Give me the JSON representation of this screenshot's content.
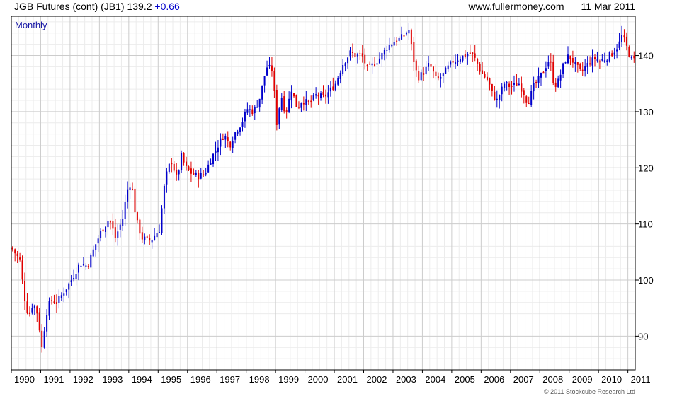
{
  "header": {
    "instrument": "JGB Futures (cont) (JB1)",
    "last": "139.2",
    "change": "+0.66",
    "site": "www.fullermoney.com",
    "date": "11 Mar 2011"
  },
  "copyright": "© 2011 Stockcube Research Ltd",
  "colors": {
    "up": "#0000cc",
    "down": "#e00000",
    "grid": "#cccccc",
    "minor_grid": "#ececec",
    "interval_label": "#1a1aa6"
  },
  "chart_data": {
    "type": "candlestick",
    "interval_label": "Monthly",
    "x_start_year": 1990,
    "x_end_year": 2011.25,
    "ylim": [
      84,
      147
    ],
    "y_ticks": [
      90,
      100,
      110,
      120,
      130,
      140
    ],
    "x_tick_labels": [
      "1990",
      "1991",
      "1992",
      "1993",
      "1994",
      "1995",
      "1996",
      "1997",
      "1998",
      "1999",
      "2000",
      "2001",
      "2002",
      "2003",
      "2004",
      "2005",
      "2006",
      "2007",
      "2008",
      "2009",
      "2010",
      "2011"
    ],
    "grid": true,
    "close_anchors": [
      [
        1990.0,
        105.5
      ],
      [
        1990.25,
        103.5
      ],
      [
        1990.4,
        97
      ],
      [
        1990.55,
        93.5
      ],
      [
        1990.7,
        96
      ],
      [
        1990.85,
        94
      ],
      [
        1991.0,
        88
      ],
      [
        1991.15,
        94
      ],
      [
        1991.3,
        96.5
      ],
      [
        1991.5,
        96
      ],
      [
        1991.7,
        97.5
      ],
      [
        1992.0,
        100
      ],
      [
        1992.3,
        103
      ],
      [
        1992.55,
        102.5
      ],
      [
        1992.8,
        106
      ],
      [
        1993.0,
        108.5
      ],
      [
        1993.3,
        111
      ],
      [
        1993.5,
        107.5
      ],
      [
        1993.75,
        111
      ],
      [
        1993.9,
        116
      ],
      [
        1994.05,
        117.5
      ],
      [
        1994.2,
        111
      ],
      [
        1994.4,
        107.5
      ],
      [
        1994.7,
        107
      ],
      [
        1995.0,
        109
      ],
      [
        1995.2,
        118
      ],
      [
        1995.4,
        121.5
      ],
      [
        1995.6,
        118
      ],
      [
        1995.75,
        122
      ],
      [
        1995.9,
        120
      ],
      [
        1996.1,
        119
      ],
      [
        1996.35,
        118.5
      ],
      [
        1996.55,
        119
      ],
      [
        1996.75,
        121.5
      ],
      [
        1997.0,
        124
      ],
      [
        1997.2,
        126
      ],
      [
        1997.4,
        124
      ],
      [
        1997.6,
        126.5
      ],
      [
        1997.8,
        128
      ],
      [
        1998.0,
        130.5
      ],
      [
        1998.2,
        130
      ],
      [
        1998.4,
        132
      ],
      [
        1998.65,
        138
      ],
      [
        1998.85,
        137.5
      ],
      [
        1999.0,
        128
      ],
      [
        1999.15,
        133
      ],
      [
        1999.3,
        129.5
      ],
      [
        1999.5,
        134
      ],
      [
        1999.7,
        130.5
      ],
      [
        1999.85,
        132
      ],
      [
        2000.1,
        131.5
      ],
      [
        2000.35,
        133
      ],
      [
        2000.6,
        132.5
      ],
      [
        2000.85,
        134
      ],
      [
        2001.0,
        135
      ],
      [
        2001.25,
        138.5
      ],
      [
        2001.5,
        140.5
      ],
      [
        2001.7,
        140
      ],
      [
        2001.9,
        140
      ],
      [
        2002.1,
        137.5
      ],
      [
        2002.3,
        138.5
      ],
      [
        2002.5,
        139.5
      ],
      [
        2002.75,
        141.5
      ],
      [
        2003.0,
        142.5
      ],
      [
        2003.2,
        143
      ],
      [
        2003.5,
        144.5
      ],
      [
        2003.65,
        139.5
      ],
      [
        2003.8,
        136
      ],
      [
        2004.0,
        137
      ],
      [
        2004.2,
        138.5
      ],
      [
        2004.45,
        135.5
      ],
      [
        2004.65,
        136.5
      ],
      [
        2004.85,
        138
      ],
      [
        2005.0,
        139
      ],
      [
        2005.2,
        139.5
      ],
      [
        2005.4,
        140
      ],
      [
        2005.6,
        140.5
      ],
      [
        2005.8,
        139
      ],
      [
        2005.95,
        137
      ],
      [
        2006.2,
        135.5
      ],
      [
        2006.35,
        133
      ],
      [
        2006.5,
        132
      ],
      [
        2006.75,
        135
      ],
      [
        2006.95,
        134.5
      ],
      [
        2007.25,
        135
      ],
      [
        2007.4,
        133.5
      ],
      [
        2007.55,
        131.5
      ],
      [
        2007.75,
        134.5
      ],
      [
        2007.95,
        136
      ],
      [
        2008.15,
        138
      ],
      [
        2008.3,
        139.5
      ],
      [
        2008.45,
        134.5
      ],
      [
        2008.6,
        135.5
      ],
      [
        2008.8,
        139
      ],
      [
        2008.95,
        140
      ],
      [
        2009.15,
        138.5
      ],
      [
        2009.35,
        137
      ],
      [
        2009.5,
        138
      ],
      [
        2009.7,
        139
      ],
      [
        2009.85,
        139.5
      ],
      [
        2010.0,
        139
      ],
      [
        2010.2,
        139.5
      ],
      [
        2010.45,
        140.5
      ],
      [
        2010.65,
        142
      ],
      [
        2010.75,
        143.5
      ],
      [
        2010.85,
        142.5
      ],
      [
        2010.95,
        141
      ],
      [
        2011.05,
        139.5
      ],
      [
        2011.15,
        139.2
      ]
    ]
  }
}
